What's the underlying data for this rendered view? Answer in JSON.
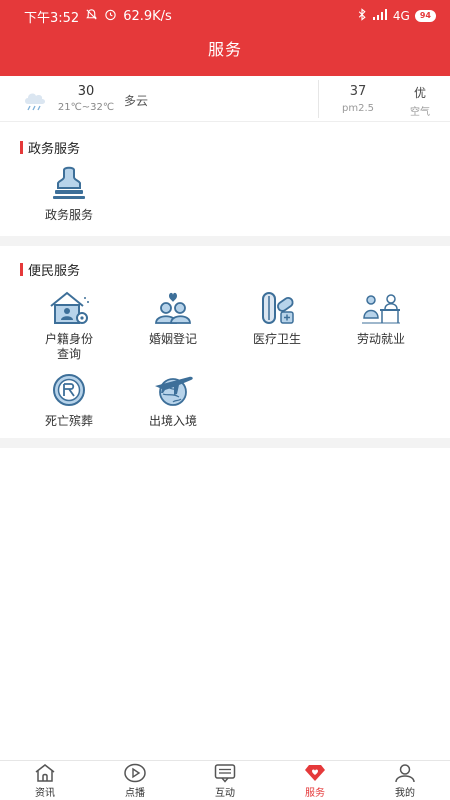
{
  "status_bar": {
    "time": "下午3:52",
    "net_speed": "62.9K/s",
    "network": "4G",
    "battery": "94"
  },
  "header": {
    "title": "服务"
  },
  "weather": {
    "temp": "30",
    "range": "21℃~32℃",
    "desc": "多云",
    "pm_value": "37",
    "pm_label": "pm2.5",
    "aq_value": "优",
    "aq_label": "空气"
  },
  "gov_section": {
    "title": "政务服务",
    "items": [
      {
        "label": "政务服务",
        "icon": "stamp-icon"
      }
    ]
  },
  "people_section": {
    "title": "便民服务",
    "items": [
      {
        "label": "户籍身份查询",
        "line1": "户籍身份",
        "line2": "查询",
        "icon": "household-id-icon"
      },
      {
        "label": "婚姻登记",
        "icon": "marriage-icon"
      },
      {
        "label": "医疗卫生",
        "icon": "medical-icon"
      },
      {
        "label": "劳动就业",
        "icon": "employment-icon"
      },
      {
        "label": "死亡殡葬",
        "icon": "funeral-icon"
      },
      {
        "label": "出境入境",
        "icon": "airplane-icon"
      }
    ]
  },
  "tabbar": {
    "tabs": [
      {
        "label": "资讯",
        "icon": "home-icon"
      },
      {
        "label": "点播",
        "icon": "play-icon"
      },
      {
        "label": "互动",
        "icon": "chat-icon"
      },
      {
        "label": "服务",
        "icon": "diamond-heart-icon",
        "active": true
      },
      {
        "label": "我的",
        "icon": "user-icon"
      }
    ]
  },
  "colors": {
    "accent": "#e5393a",
    "icon_blue": "#3d6f99",
    "icon_light": "#b7d3ea"
  }
}
